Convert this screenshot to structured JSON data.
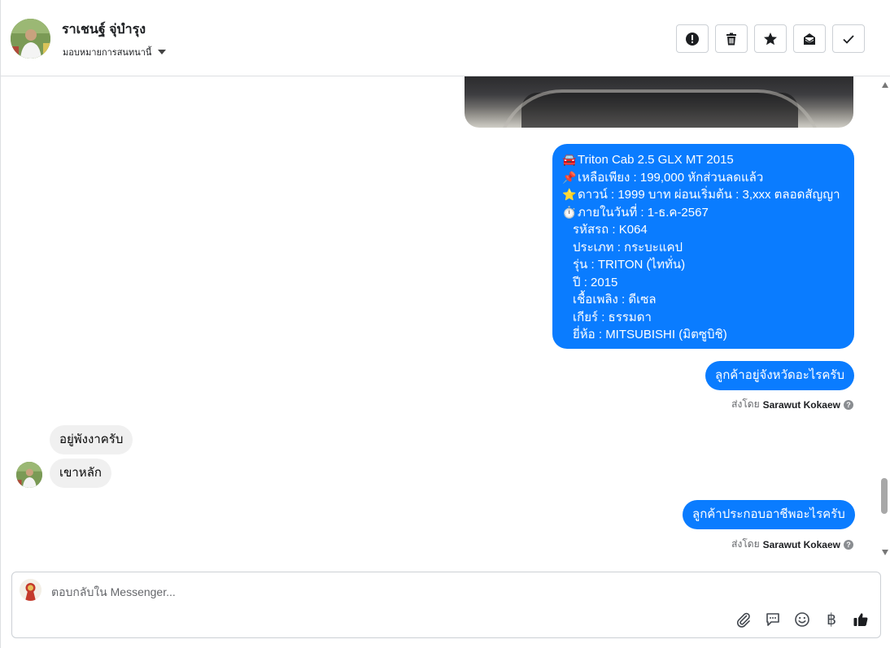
{
  "header": {
    "contact_name": "ราเชนฐ์ จุ่บำรุง",
    "assign_label": "มอบหมายการสนทนานี้",
    "actions": {
      "spam_icon": "exclamation-circle-icon",
      "delete_icon": "trash-icon",
      "star_icon": "star-icon",
      "unread_icon": "mail-open-icon",
      "done_icon": "check-icon"
    }
  },
  "conversation": {
    "listing_message": {
      "line1": "Triton Cab 2.5 GLX MT 2015",
      "line2": "เหลือเพียง : 199,000 หักส่วนลดแล้ว",
      "line3": "ดาวน์ : 1999 บาท ผ่อนเริ่มต้น : 3,xxx ตลอดสัญญา",
      "line4": "ภายในวันที่ : 1-ธ.ค-2567",
      "line5": "รหัสรถ : K064",
      "line6": "ประเภท : กระบะแคป",
      "line7": "รุ่น : TRITON (ไททั่น)",
      "line8": "ปี : 2015",
      "line9": "เชื้อเพลิง : ดีเซล",
      "line10": "เกียร์ : ธรรมดา",
      "line11": "ยี่ห้อ : MITSUBISHI (มิตซูบิชิ)",
      "emoji1": "🚘",
      "emoji2": "📌",
      "emoji3": "⭐",
      "emoji4": "⏱️"
    },
    "msg_province": "ลูกค้าอยู่จังหวัดอะไรครับ",
    "sent_by_prefix": "ส่งโดย",
    "sent_by_name": "Sarawut Kokaew",
    "incoming1": "อยู่พังงาครับ",
    "incoming2": "เขาหลัก",
    "msg_career": "ลูกค้าประกอบอาชีพอะไรครับ",
    "help_mark": "?"
  },
  "composer": {
    "placeholder": "ตอบกลับใน Messenger...",
    "baht_symbol": "฿"
  },
  "colors": {
    "outgoing_bubble": "#0a7cff",
    "incoming_bubble": "#f0f0f0"
  }
}
